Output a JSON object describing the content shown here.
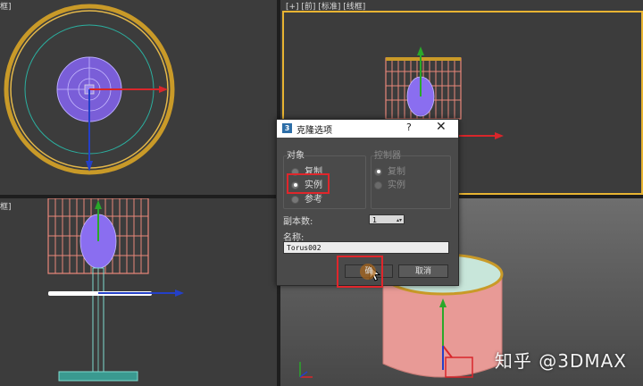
{
  "viewports": {
    "top_right_label": "[+] [前] [标准] [线框]",
    "top_left_label": "框]",
    "bottom_left_label": "框]"
  },
  "clone_dialog": {
    "app_icon": "3",
    "title": "克隆选项",
    "help": "?",
    "close": "✕",
    "object_group_label": "对象",
    "object_options": [
      {
        "label": "复制",
        "selected": false
      },
      {
        "label": "实例",
        "selected": true
      },
      {
        "label": "参考",
        "selected": false
      }
    ],
    "controller_group_label": "控制器",
    "controller_options": [
      {
        "label": "复制",
        "selected": true
      },
      {
        "label": "实例",
        "selected": false
      }
    ],
    "copies_label": "副本数:",
    "copies_value": "1",
    "spinner_arrows": "▴▾",
    "name_label": "名称:",
    "name_value": "Torus002",
    "ok_label": "确",
    "cancel_label": "取消"
  },
  "watermark": "知乎 @3DMAX",
  "colors": {
    "viewport_bg": "#3c3c3c",
    "active_border": "#e8b432",
    "highlight_red": "#e0262b",
    "lamp_red": "#e9877a",
    "sphere_purple": "#8a6ef0"
  }
}
